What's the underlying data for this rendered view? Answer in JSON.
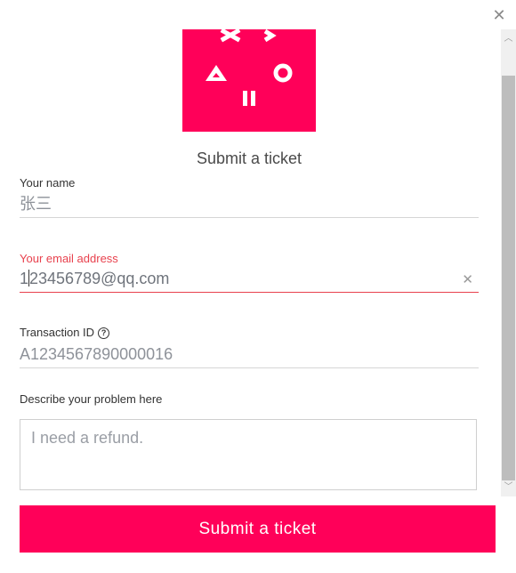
{
  "title": "Submit a ticket",
  "fields": {
    "name": {
      "label": "Your name",
      "value": "张三"
    },
    "email": {
      "label": "Your email address",
      "value_first": "1",
      "value_rest": "23456789@qq.com"
    },
    "transaction": {
      "label": "Transaction ID",
      "value": "A1234567890000016"
    },
    "problem": {
      "label": "Describe your problem here",
      "value": "I need a refund."
    }
  },
  "submit_label": "Submit a ticket",
  "icons": {
    "close": "close-icon",
    "help": "question-circle-icon",
    "clear": "clear-input-icon"
  },
  "colors": {
    "brand": "#ff0059",
    "error": "#e8424e"
  }
}
